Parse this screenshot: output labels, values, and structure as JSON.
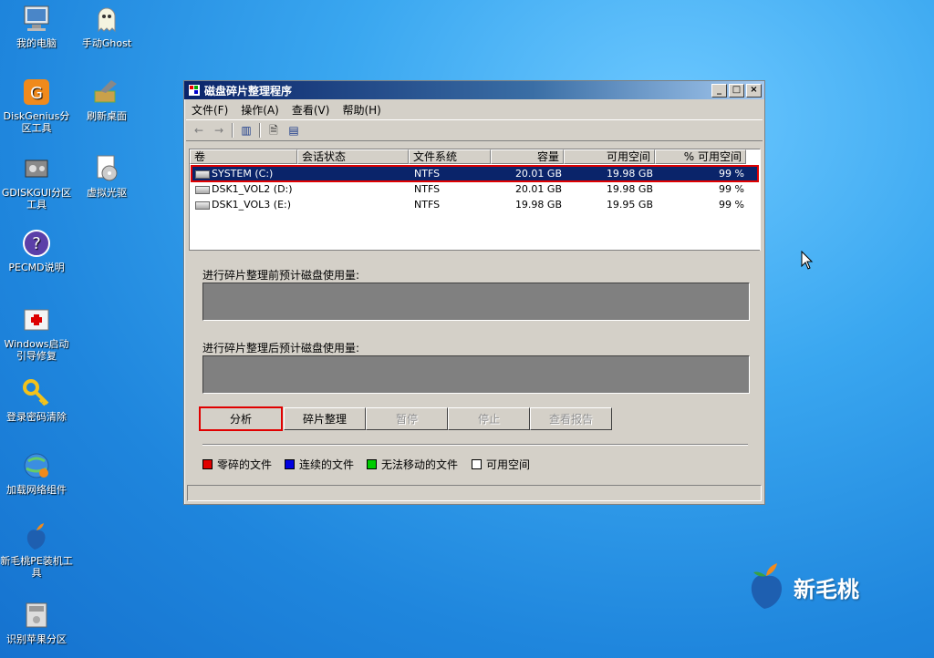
{
  "desktop": {
    "icons": [
      {
        "label": "我的电脑",
        "icon": "computer-icon"
      },
      {
        "label": "手动Ghost",
        "icon": "ghost-icon"
      },
      {
        "label": "DiskGenius分区工具",
        "icon": "diskgenius-icon"
      },
      {
        "label": "刷新桌面",
        "icon": "refresh-desktop-icon"
      },
      {
        "label": "GDISKGUI分区工具",
        "icon": "gdisk-icon"
      },
      {
        "label": "虚拟光驱",
        "icon": "virtual-drive-icon"
      },
      {
        "label": "PECMD说明",
        "icon": "help-icon"
      },
      {
        "label": "Windows启动引导修复",
        "icon": "boot-repair-icon"
      },
      {
        "label": "登录密码清除",
        "icon": "key-icon"
      },
      {
        "label": "加载网络组件",
        "icon": "network-icon"
      },
      {
        "label": "新毛桃PE装机工具",
        "icon": "peach-icon"
      },
      {
        "label": "识别苹果分区",
        "icon": "disk-icon"
      }
    ]
  },
  "window": {
    "title": "磁盘碎片整理程序",
    "buttons": {
      "minimize": "_",
      "maximize": "□",
      "close": "×"
    },
    "menu": [
      "文件(F)",
      "操作(A)",
      "查看(V)",
      "帮助(H)"
    ],
    "columns": [
      "卷",
      "会话状态",
      "文件系统",
      "容量",
      "可用空间",
      "% 可用空间"
    ],
    "rows": [
      {
        "volume": "SYSTEM (C:)",
        "status": "",
        "fs": "NTFS",
        "capacity": "20.01 GB",
        "free": "19.98 GB",
        "pct": "99 %"
      },
      {
        "volume": "DSK1_VOL2 (D:)",
        "status": "",
        "fs": "NTFS",
        "capacity": "20.01 GB",
        "free": "19.98 GB",
        "pct": "99 %"
      },
      {
        "volume": "DSK1_VOL3 (E:)",
        "status": "",
        "fs": "NTFS",
        "capacity": "19.98 GB",
        "free": "19.95 GB",
        "pct": "99 %"
      }
    ],
    "before_label": "进行碎片整理前预计磁盘使用量:",
    "after_label": "进行碎片整理后预计磁盘使用量:",
    "actions": [
      "分析",
      "碎片整理",
      "暂停",
      "停止",
      "查看报告"
    ],
    "legend": [
      {
        "label": "零碎的文件",
        "color": "#e00000"
      },
      {
        "label": "连续的文件",
        "color": "#0000e0"
      },
      {
        "label": "无法移动的文件",
        "color": "#00cc00"
      },
      {
        "label": "可用空间",
        "color": "#ffffff"
      }
    ]
  },
  "brand": {
    "text": "新毛桃"
  }
}
